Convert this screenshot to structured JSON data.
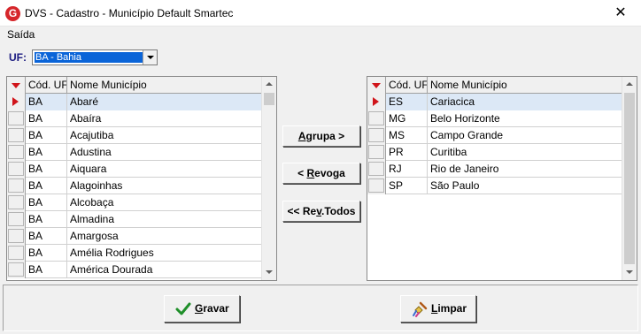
{
  "window": {
    "title": "DVS - Cadastro - Município Default Smartec",
    "icon_letter": "G",
    "close_glyph": "✕"
  },
  "menu": {
    "items": [
      "Saída"
    ]
  },
  "uf": {
    "label": "UF:",
    "selected": "BA - Bahia"
  },
  "left_grid": {
    "columns": [
      "Cód. UF",
      "Nome Município"
    ],
    "rows": [
      [
        "BA",
        "Abaré"
      ],
      [
        "BA",
        "Abaíra"
      ],
      [
        "BA",
        "Acajutiba"
      ],
      [
        "BA",
        "Adustina"
      ],
      [
        "BA",
        "Aiquara"
      ],
      [
        "BA",
        "Alagoinhas"
      ],
      [
        "BA",
        "Alcobaça"
      ],
      [
        "BA",
        "Almadina"
      ],
      [
        "BA",
        "Amargosa"
      ],
      [
        "BA",
        "Amélia Rodrigues"
      ],
      [
        "BA",
        "América Dourada"
      ]
    ],
    "selected_row": 0
  },
  "right_grid": {
    "columns": [
      "Cód. UF",
      "Nome Município"
    ],
    "rows": [
      [
        "ES",
        "Cariacica"
      ],
      [
        "MG",
        "Belo Horizonte"
      ],
      [
        "MS",
        "Campo Grande"
      ],
      [
        "PR",
        "Curitiba"
      ],
      [
        "RJ",
        "Rio de Janeiro"
      ],
      [
        "SP",
        "São Paulo"
      ]
    ],
    "selected_row": 0
  },
  "buttons": {
    "agrupa": {
      "pre": "",
      "accel": "A",
      "post": "grupa >"
    },
    "revoga": {
      "pre": "< ",
      "accel": "R",
      "post": "evoga"
    },
    "rev_todos": {
      "pre": "<< Re",
      "accel": "v",
      "post": ".Todos"
    },
    "gravar": {
      "pre": "",
      "accel": "G",
      "post": "ravar"
    },
    "limpar": {
      "pre": "",
      "accel": "L",
      "post": "impar"
    }
  },
  "colors": {
    "accent_red": "#d0141a",
    "selection_blue": "#0a64d8",
    "row_highlight": "#dce8f6",
    "uf_label": "#1a1a80"
  }
}
